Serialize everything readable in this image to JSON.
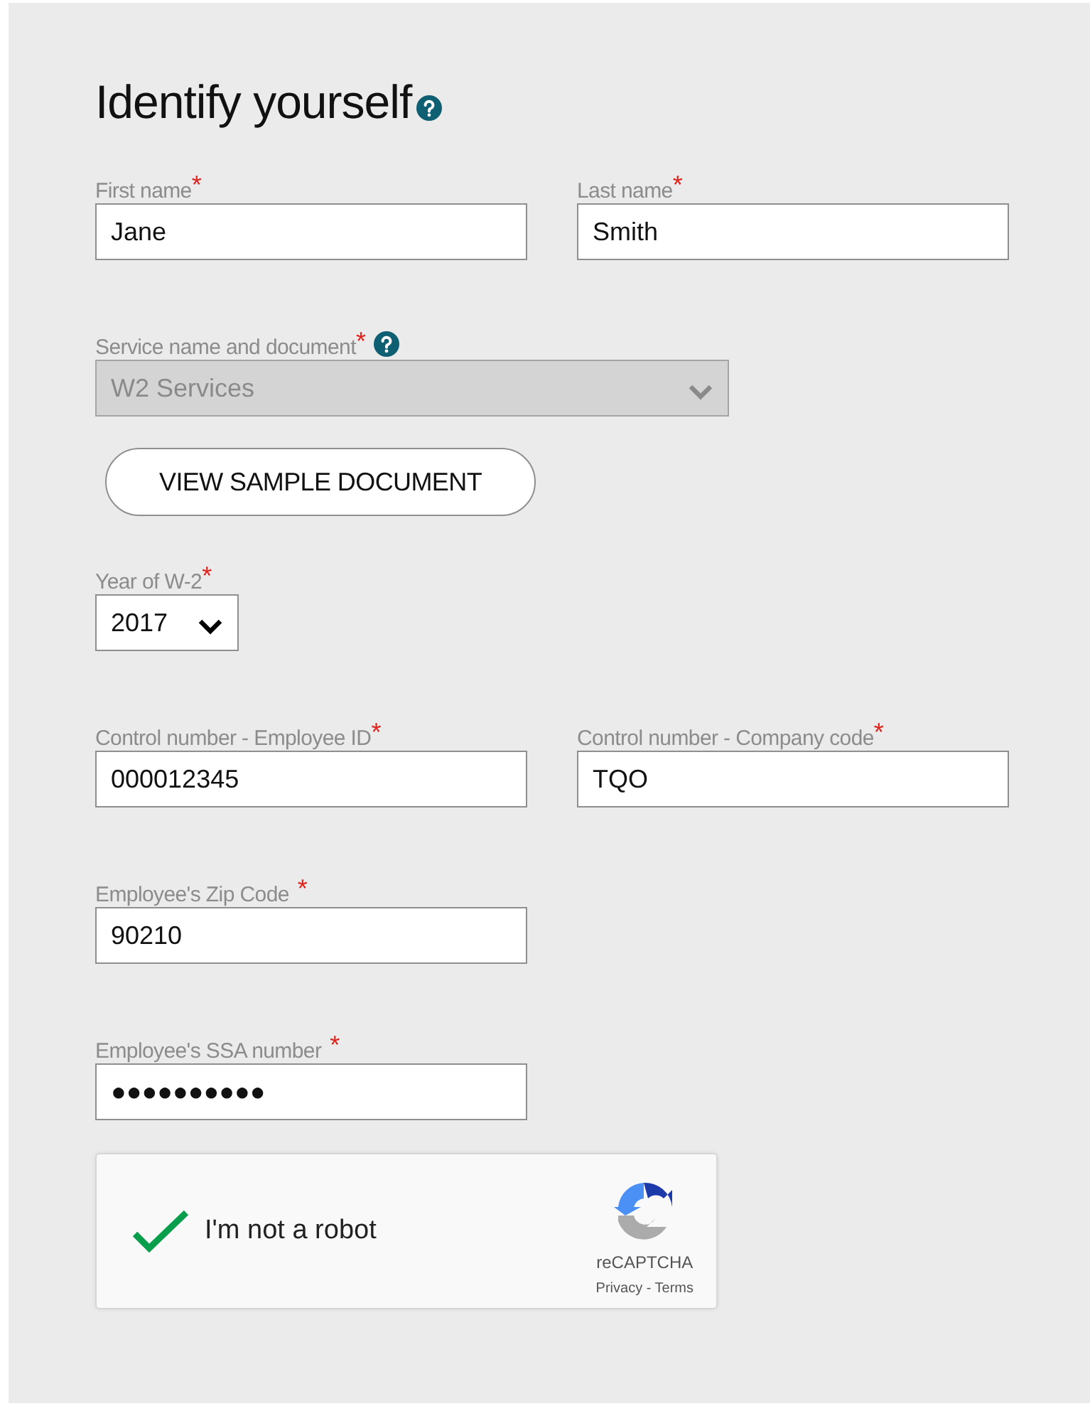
{
  "heading": {
    "title": "Identify yourself",
    "help": true
  },
  "rows": [
    {
      "kind": "fields",
      "fields": [
        {
          "label": "First name",
          "required_mark": "*",
          "kind": "text",
          "value": "Jane",
          "disabled": false
        },
        {
          "label": "Last name",
          "required_mark": "*",
          "kind": "text",
          "value": "Smith",
          "disabled": false
        }
      ]
    },
    {
      "kind": "fields",
      "fields": [
        {
          "label": "Service name and document",
          "required_mark": "*",
          "help": true,
          "kind": "select",
          "value": "W2 Services",
          "disabled": true
        }
      ]
    },
    {
      "kind": "button",
      "label": "VIEW SAMPLE DOCUMENT"
    },
    {
      "kind": "fields",
      "fields": [
        {
          "label": "Year of W-2",
          "required_mark": "*",
          "kind": "small_select",
          "value": "2017",
          "disabled": false
        }
      ]
    },
    {
      "kind": "fields",
      "fields": [
        {
          "label": "Control number - Employee ID",
          "required_mark": "*",
          "kind": "text",
          "value": "000012345",
          "disabled": false
        },
        {
          "label": "Control number - Company code",
          "required_mark": "*",
          "kind": "text",
          "value": "TQO",
          "disabled": false
        }
      ]
    },
    {
      "kind": "fields",
      "fields": [
        {
          "label": "Employee's Zip Code",
          "required_mark": "*",
          "mark_spaced": true,
          "kind": "text",
          "value": "90210",
          "disabled": false
        }
      ]
    },
    {
      "kind": "fields",
      "fields": [
        {
          "label": "Employee's SSA number",
          "required_mark": "*",
          "mark_spaced": true,
          "kind": "password",
          "value": "●●●●●●●●●●",
          "disabled": false
        }
      ]
    },
    {
      "kind": "captcha",
      "label": "I'm not a robot",
      "checked": true,
      "brand": "reCAPTCHA",
      "links": "Privacy - Terms"
    }
  ]
}
